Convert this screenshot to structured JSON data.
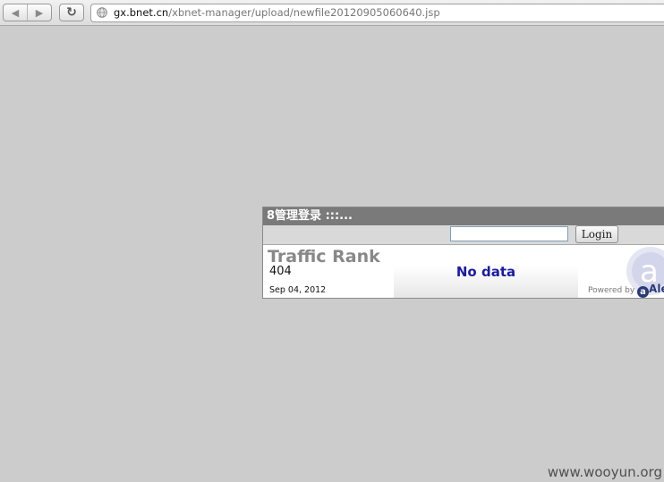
{
  "browser": {
    "back_glyph": "◀",
    "forward_glyph": "▶",
    "reload_glyph": "↻",
    "address_host": "gx.bnet.cn",
    "address_path": "/xbnet-manager/upload/newfile20120905060640.jsp"
  },
  "panel": {
    "title": "8管理登录 :::...",
    "login_input_value": "",
    "login_button_label": "Login"
  },
  "alexa_widget": {
    "rank_title": "Traffic Rank",
    "rank_value": "404",
    "date": "Sep 04, 2012",
    "status_text": "No data",
    "powered_by_label": "Powered by",
    "brand_name": "Ale",
    "status_color": "#1a1aa6"
  },
  "watermark": "www.wooyun.org"
}
